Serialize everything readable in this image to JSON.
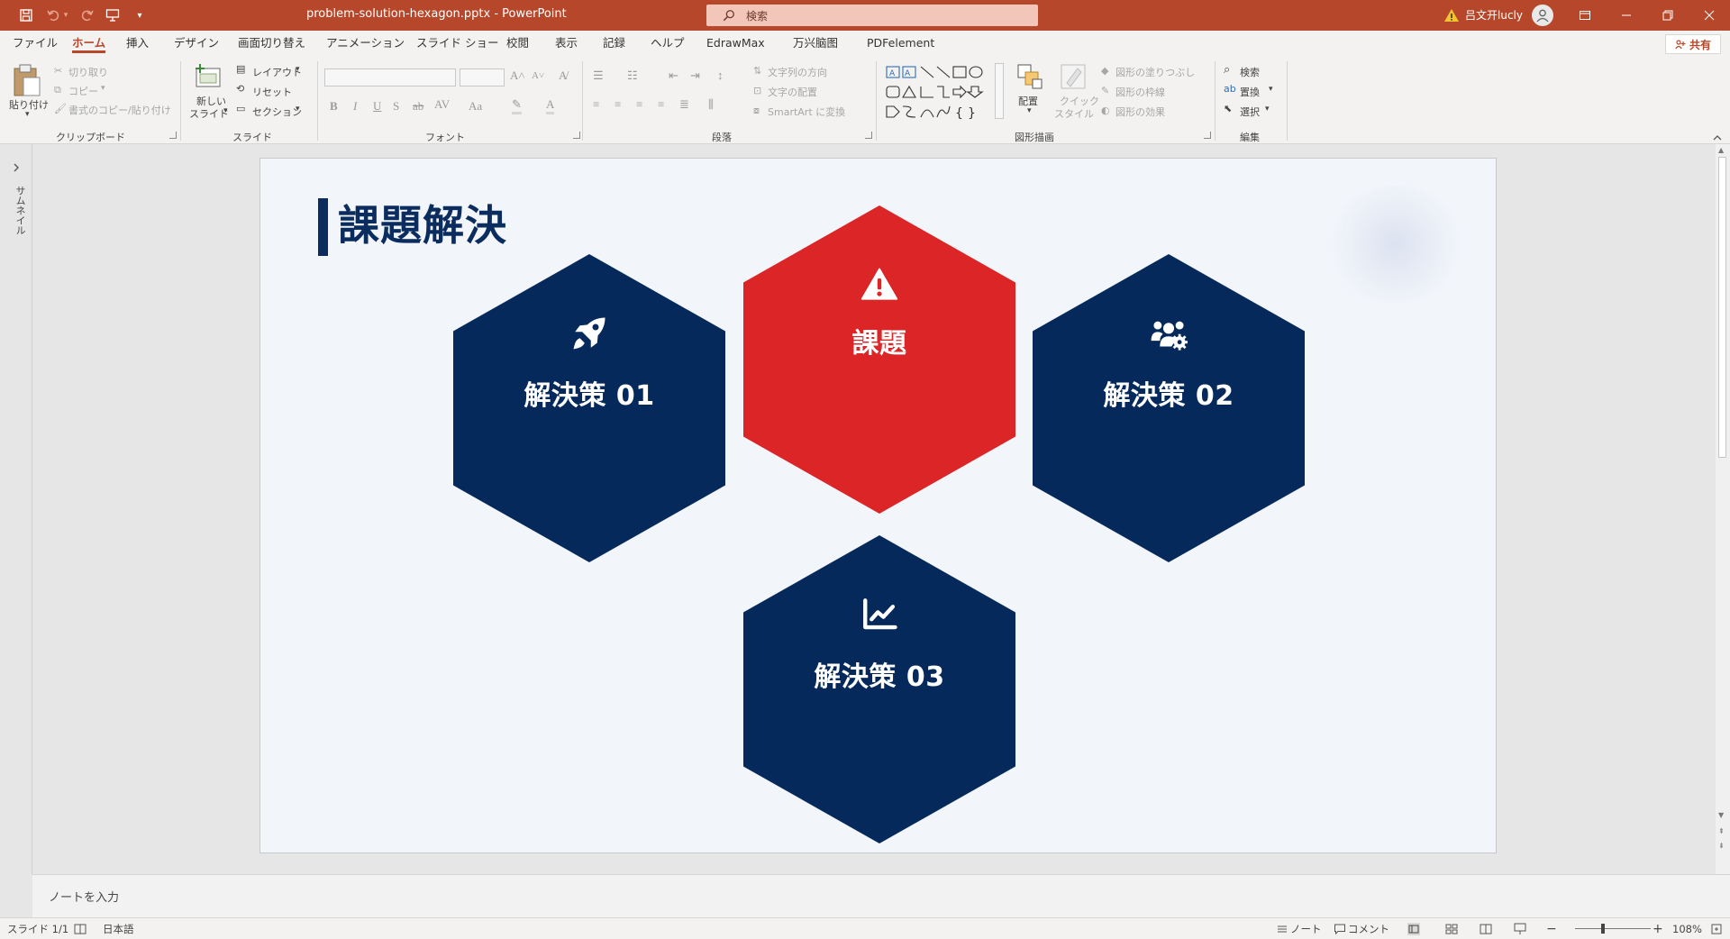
{
  "app": {
    "document_title": "problem-solution-hexagon.pptx  -  PowerPoint",
    "search_placeholder": "検索",
    "user_name": "吕文开lucly",
    "share_label": "共有"
  },
  "menu": {
    "tabs": [
      "ファイル",
      "ホーム",
      "挿入",
      "デザイン",
      "画面切り替え",
      "アニメーション",
      "スライド ショー",
      "校閲",
      "表示",
      "記録",
      "ヘルプ",
      "EdrawMax",
      "万兴脑图",
      "PDFelement"
    ],
    "active_tab": "ホーム"
  },
  "ribbon": {
    "clipboard": {
      "paste": "貼り付け",
      "cut": "切り取り",
      "copy": "コピー",
      "format_painter": "書式のコピー/貼り付け",
      "group": "クリップボード"
    },
    "slides": {
      "new_slide_1": "新しい",
      "new_slide_2": "スライド",
      "layout": "レイアウト",
      "reset": "リセット",
      "section": "セクション",
      "group": "スライド"
    },
    "font": {
      "group": "フォント"
    },
    "paragraph": {
      "text_direction": "文字列の方向",
      "align_text": "文字の配置",
      "smartart": "SmartArt に変換",
      "group": "段落"
    },
    "drawing": {
      "arrange": "配置",
      "quick_styles_1": "クイック",
      "quick_styles_2": "スタイル",
      "shape_fill": "図形の塗りつぶし",
      "shape_outline": "図形の枠線",
      "shape_effects": "図形の効果",
      "group": "図形描画"
    },
    "editing": {
      "find": "検索",
      "replace": "置換",
      "select": "選択",
      "group": "編集"
    }
  },
  "thumbnail_pane": {
    "label": "サムネイル"
  },
  "slide": {
    "title": "課題解決",
    "hexagons": [
      {
        "id": "problem",
        "label": "課題",
        "icon": "warning-icon",
        "color": "#dc2526"
      },
      {
        "id": "solution1",
        "label": "解決策 01",
        "icon": "rocket-icon",
        "color": "#06295b"
      },
      {
        "id": "solution2",
        "label": "解決策 02",
        "icon": "users-gear-icon",
        "color": "#06295b"
      },
      {
        "id": "solution3",
        "label": "解決策 03",
        "icon": "chart-line-icon",
        "color": "#06295b"
      }
    ]
  },
  "notes": {
    "placeholder": "ノートを入力"
  },
  "status": {
    "slide_count": "スライド 1/1",
    "language": "日本語",
    "notes": "ノート",
    "comments": "コメント",
    "zoom": "108%"
  },
  "colors": {
    "accent": "#b7472a",
    "navy": "#06295b",
    "red": "#dc2526",
    "slide_bg": "#f2f5fa"
  }
}
